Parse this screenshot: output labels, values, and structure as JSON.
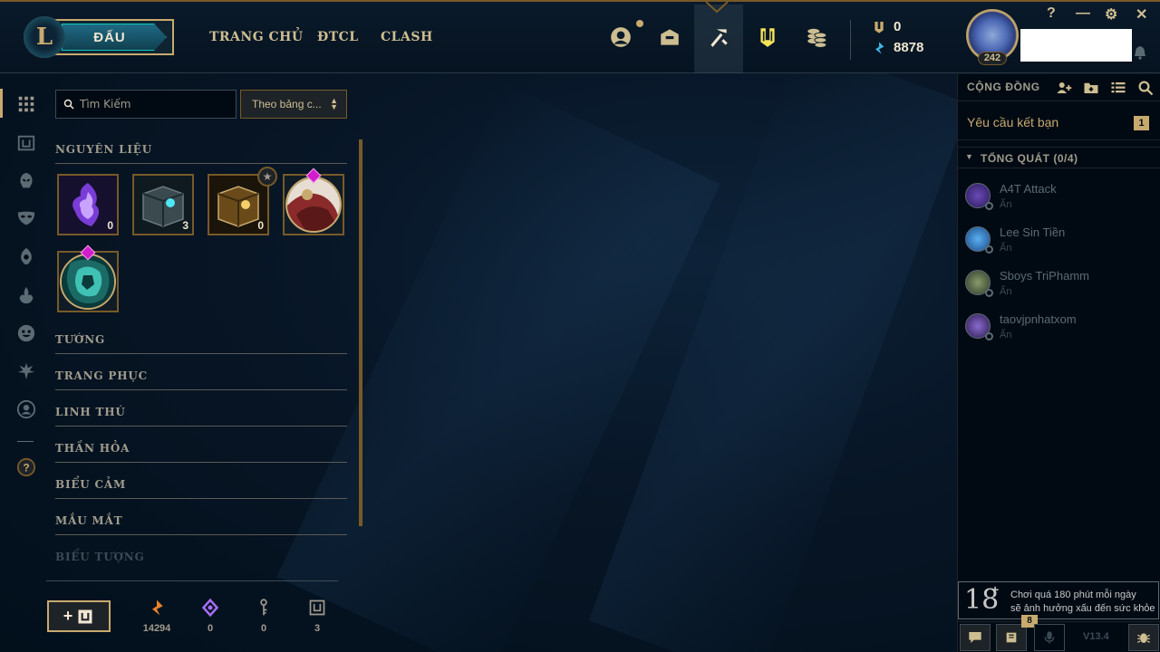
{
  "app": {
    "logo_letter": "L"
  },
  "topbar": {
    "play_label": "ĐẤU",
    "nav": [
      "TRANG CHỦ",
      "ĐTCL",
      "CLASH"
    ],
    "icons": [
      "profile-icon",
      "collection-icon",
      "loot-icon",
      "clash-trophy-icon",
      "store-icon"
    ],
    "currency_rp": "0",
    "currency_be": "8878",
    "level": "242",
    "window_controls": [
      "?",
      "—",
      "⚙",
      "✕"
    ]
  },
  "leftnav": {
    "icons": [
      "all-items-icon",
      "chest-icon",
      "champion-icon",
      "skin-icon",
      "ward-icon",
      "chroma-icon",
      "emote-icon",
      "eternals-icon",
      "profile-icon-loot",
      "help-icon"
    ]
  },
  "loot": {
    "search_placeholder": "Tìm Kiếm",
    "sort_label": "Theo bảng c...",
    "sections": {
      "materials": "NGUYÊN LIỆU",
      "champions": "TƯỚNG",
      "skins": "TRANG PHỤC",
      "pets": "LINH THÚ",
      "wards": "THẦN HỎA",
      "emotes": "BIỂU CẢM",
      "eyes": "MẮU MẮT",
      "icons": "BIỂU TƯỢNG"
    },
    "items": [
      {
        "name": "mythic-essence",
        "count": "0"
      },
      {
        "name": "hextech-chest",
        "count": "3"
      },
      {
        "name": "mastery-chest",
        "count": "0"
      },
      {
        "name": "prestige-orb",
        "count": ""
      },
      {
        "name": "event-orb",
        "count": ""
      }
    ],
    "footer": {
      "craft_label": "+",
      "blue_essence": "14294",
      "mythic": "0",
      "keys": "0",
      "chests": "3"
    }
  },
  "social": {
    "title": "CỘNG ĐỒNG",
    "friend_requests_label": "Yêu cầu kết bạn",
    "friend_requests_count": "1",
    "group_title": "TỔNG QUÁT (0/4)",
    "friends": [
      {
        "name": "A4T Attack",
        "status": "Ẩn"
      },
      {
        "name": "Lee Sin Tiền",
        "status": "Ẩn"
      },
      {
        "name": "Sboys TriPhamm",
        "status": "Ẩn"
      },
      {
        "name": "taovjpnhatxom",
        "status": "Ẩn"
      }
    ],
    "age_rating": "18",
    "age_rating_plus": "+",
    "age_warning_1": "Chơi quá 180 phút mỗi ngày",
    "age_warning_2": "sẽ ảnh hưởng xấu đến sức khỏe",
    "mission_badge": "8",
    "version": "V13.4"
  },
  "colors": {
    "gold": "#c8aa6e",
    "dark_gold": "#785a28",
    "teal": "#0ac8b9",
    "text": "#a09b8c",
    "bg": "#010a13"
  }
}
